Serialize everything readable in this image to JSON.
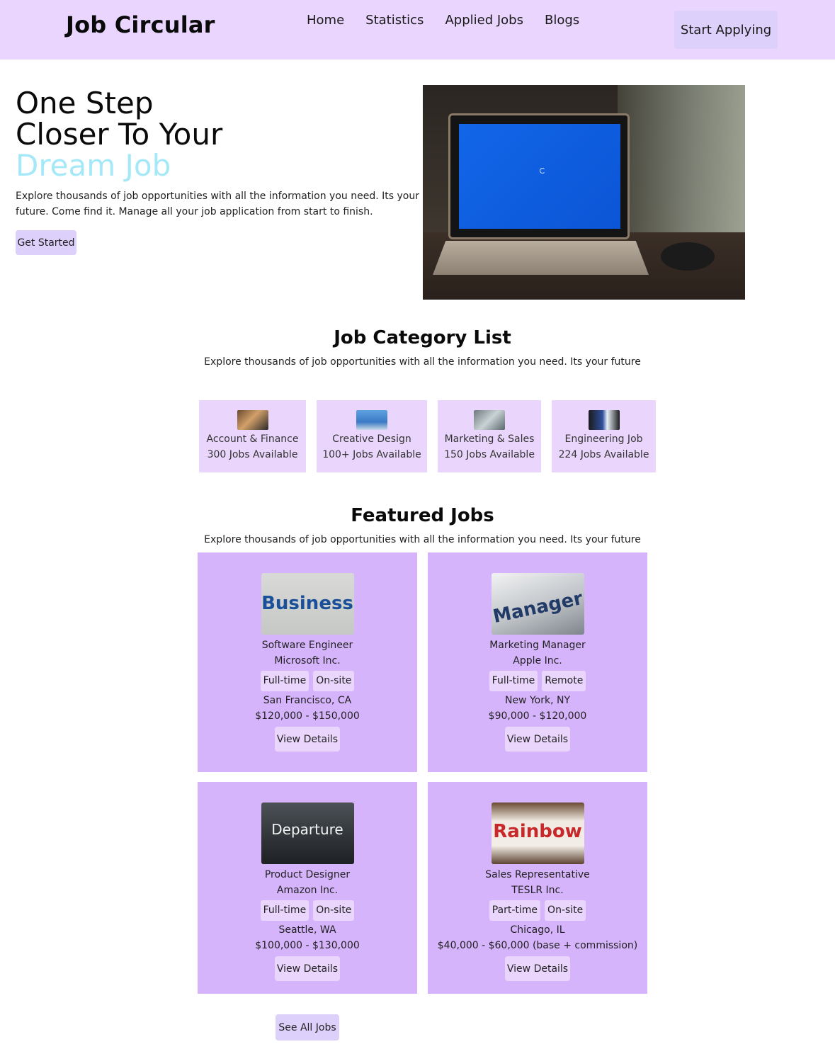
{
  "header": {
    "brand": "Job Circular",
    "nav": [
      "Home",
      "Statistics",
      "Applied Jobs",
      "Blogs"
    ],
    "cta": "Start Applying"
  },
  "hero": {
    "title_line1": "One Step",
    "title_line2": "Closer To Your",
    "title_accent": "Dream Job",
    "description": "Explore thousands of job opportunities with all the information you need. Its your future. Come find it. Manage all your job application from start to finish.",
    "button": "Get Started",
    "accent_color": "#a5e8f8"
  },
  "categories_section": {
    "title": "Job Category List",
    "subtitle": "Explore thousands of job opportunities with all the information you need. Its your future",
    "items": [
      {
        "name": "Account & Finance",
        "count": "300 Jobs Available"
      },
      {
        "name": "Creative Design",
        "count": "100+ Jobs Available"
      },
      {
        "name": "Marketing & Sales",
        "count": "150 Jobs Available"
      },
      {
        "name": "Engineering Job",
        "count": "224 Jobs Available"
      }
    ]
  },
  "featured_section": {
    "title": "Featured Jobs",
    "subtitle": "Explore thousands of job opportunities with all the information you need. Its your future",
    "jobs": [
      {
        "image_text": "Business",
        "title": "Software Engineer",
        "company": "Microsoft Inc.",
        "type": "Full-time",
        "mode": "On-site",
        "location": "San Francisco, CA",
        "salary": "$120,000 - $150,000",
        "button": "View Details"
      },
      {
        "image_text": "Manager",
        "title": "Marketing Manager",
        "company": "Apple Inc.",
        "type": "Full-time",
        "mode": "Remote",
        "location": "New York, NY",
        "salary": "$90,000 - $120,000",
        "button": "View Details"
      },
      {
        "image_text": "Departure",
        "title": "Product Designer",
        "company": "Amazon Inc.",
        "type": "Full-time",
        "mode": "On-site",
        "location": "Seattle, WA",
        "salary": "$100,000 - $130,000",
        "button": "View Details"
      },
      {
        "image_text": "Rainbow",
        "title": "Sales Representative",
        "company": "TESLR Inc.",
        "type": "Part-time",
        "mode": "On-site",
        "location": "Chicago, IL",
        "salary": "$40,000 - $60,000 (base + commission)",
        "button": "View Details"
      }
    ],
    "see_all": "See All Jobs"
  },
  "colors": {
    "navbar": "#e9d5fe",
    "button": "#ddd0fb",
    "category_card": "#ead6fd",
    "job_card": "#d6b4fb"
  }
}
